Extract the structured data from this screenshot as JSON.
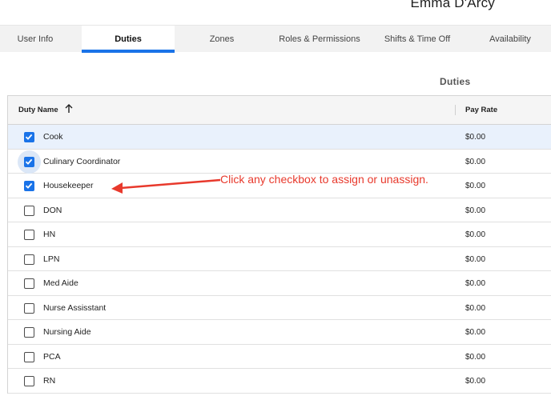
{
  "header": {
    "user_name": "Emma D'Arcy"
  },
  "tabs": [
    {
      "label": "User Info",
      "active": false
    },
    {
      "label": "Duties",
      "active": true
    },
    {
      "label": "Zones",
      "active": false
    },
    {
      "label": "Roles & Permissions",
      "active": false
    },
    {
      "label": "Shifts & Time Off",
      "active": false
    },
    {
      "label": "Availability",
      "active": false
    }
  ],
  "section": {
    "title": "Duties"
  },
  "table": {
    "columns": {
      "name": "Duty Name",
      "pay": "Pay Rate"
    },
    "sort": {
      "column": "Duty Name",
      "direction": "ascending",
      "icon": "arrow-up-icon"
    },
    "rows": [
      {
        "name": "Cook",
        "pay": "$0.00",
        "checked": true
      },
      {
        "name": "Culinary Coordinator",
        "pay": "$0.00",
        "checked": true
      },
      {
        "name": "Housekeeper",
        "pay": "$0.00",
        "checked": true
      },
      {
        "name": "DON",
        "pay": "$0.00",
        "checked": false
      },
      {
        "name": "HN",
        "pay": "$0.00",
        "checked": false
      },
      {
        "name": "LPN",
        "pay": "$0.00",
        "checked": false
      },
      {
        "name": "Med Aide",
        "pay": "$0.00",
        "checked": false
      },
      {
        "name": "Nurse Assisstant",
        "pay": "$0.00",
        "checked": false
      },
      {
        "name": "Nursing Aide",
        "pay": "$0.00",
        "checked": false
      },
      {
        "name": "PCA",
        "pay": "$0.00",
        "checked": false
      },
      {
        "name": "RN",
        "pay": "$0.00",
        "checked": false
      }
    ]
  },
  "annotation": {
    "text": "Click any checkbox to assign or unassign.",
    "color": "#e8392c"
  },
  "colors": {
    "accent": "#1a73e8",
    "row_highlight": "#e9f1fc"
  }
}
